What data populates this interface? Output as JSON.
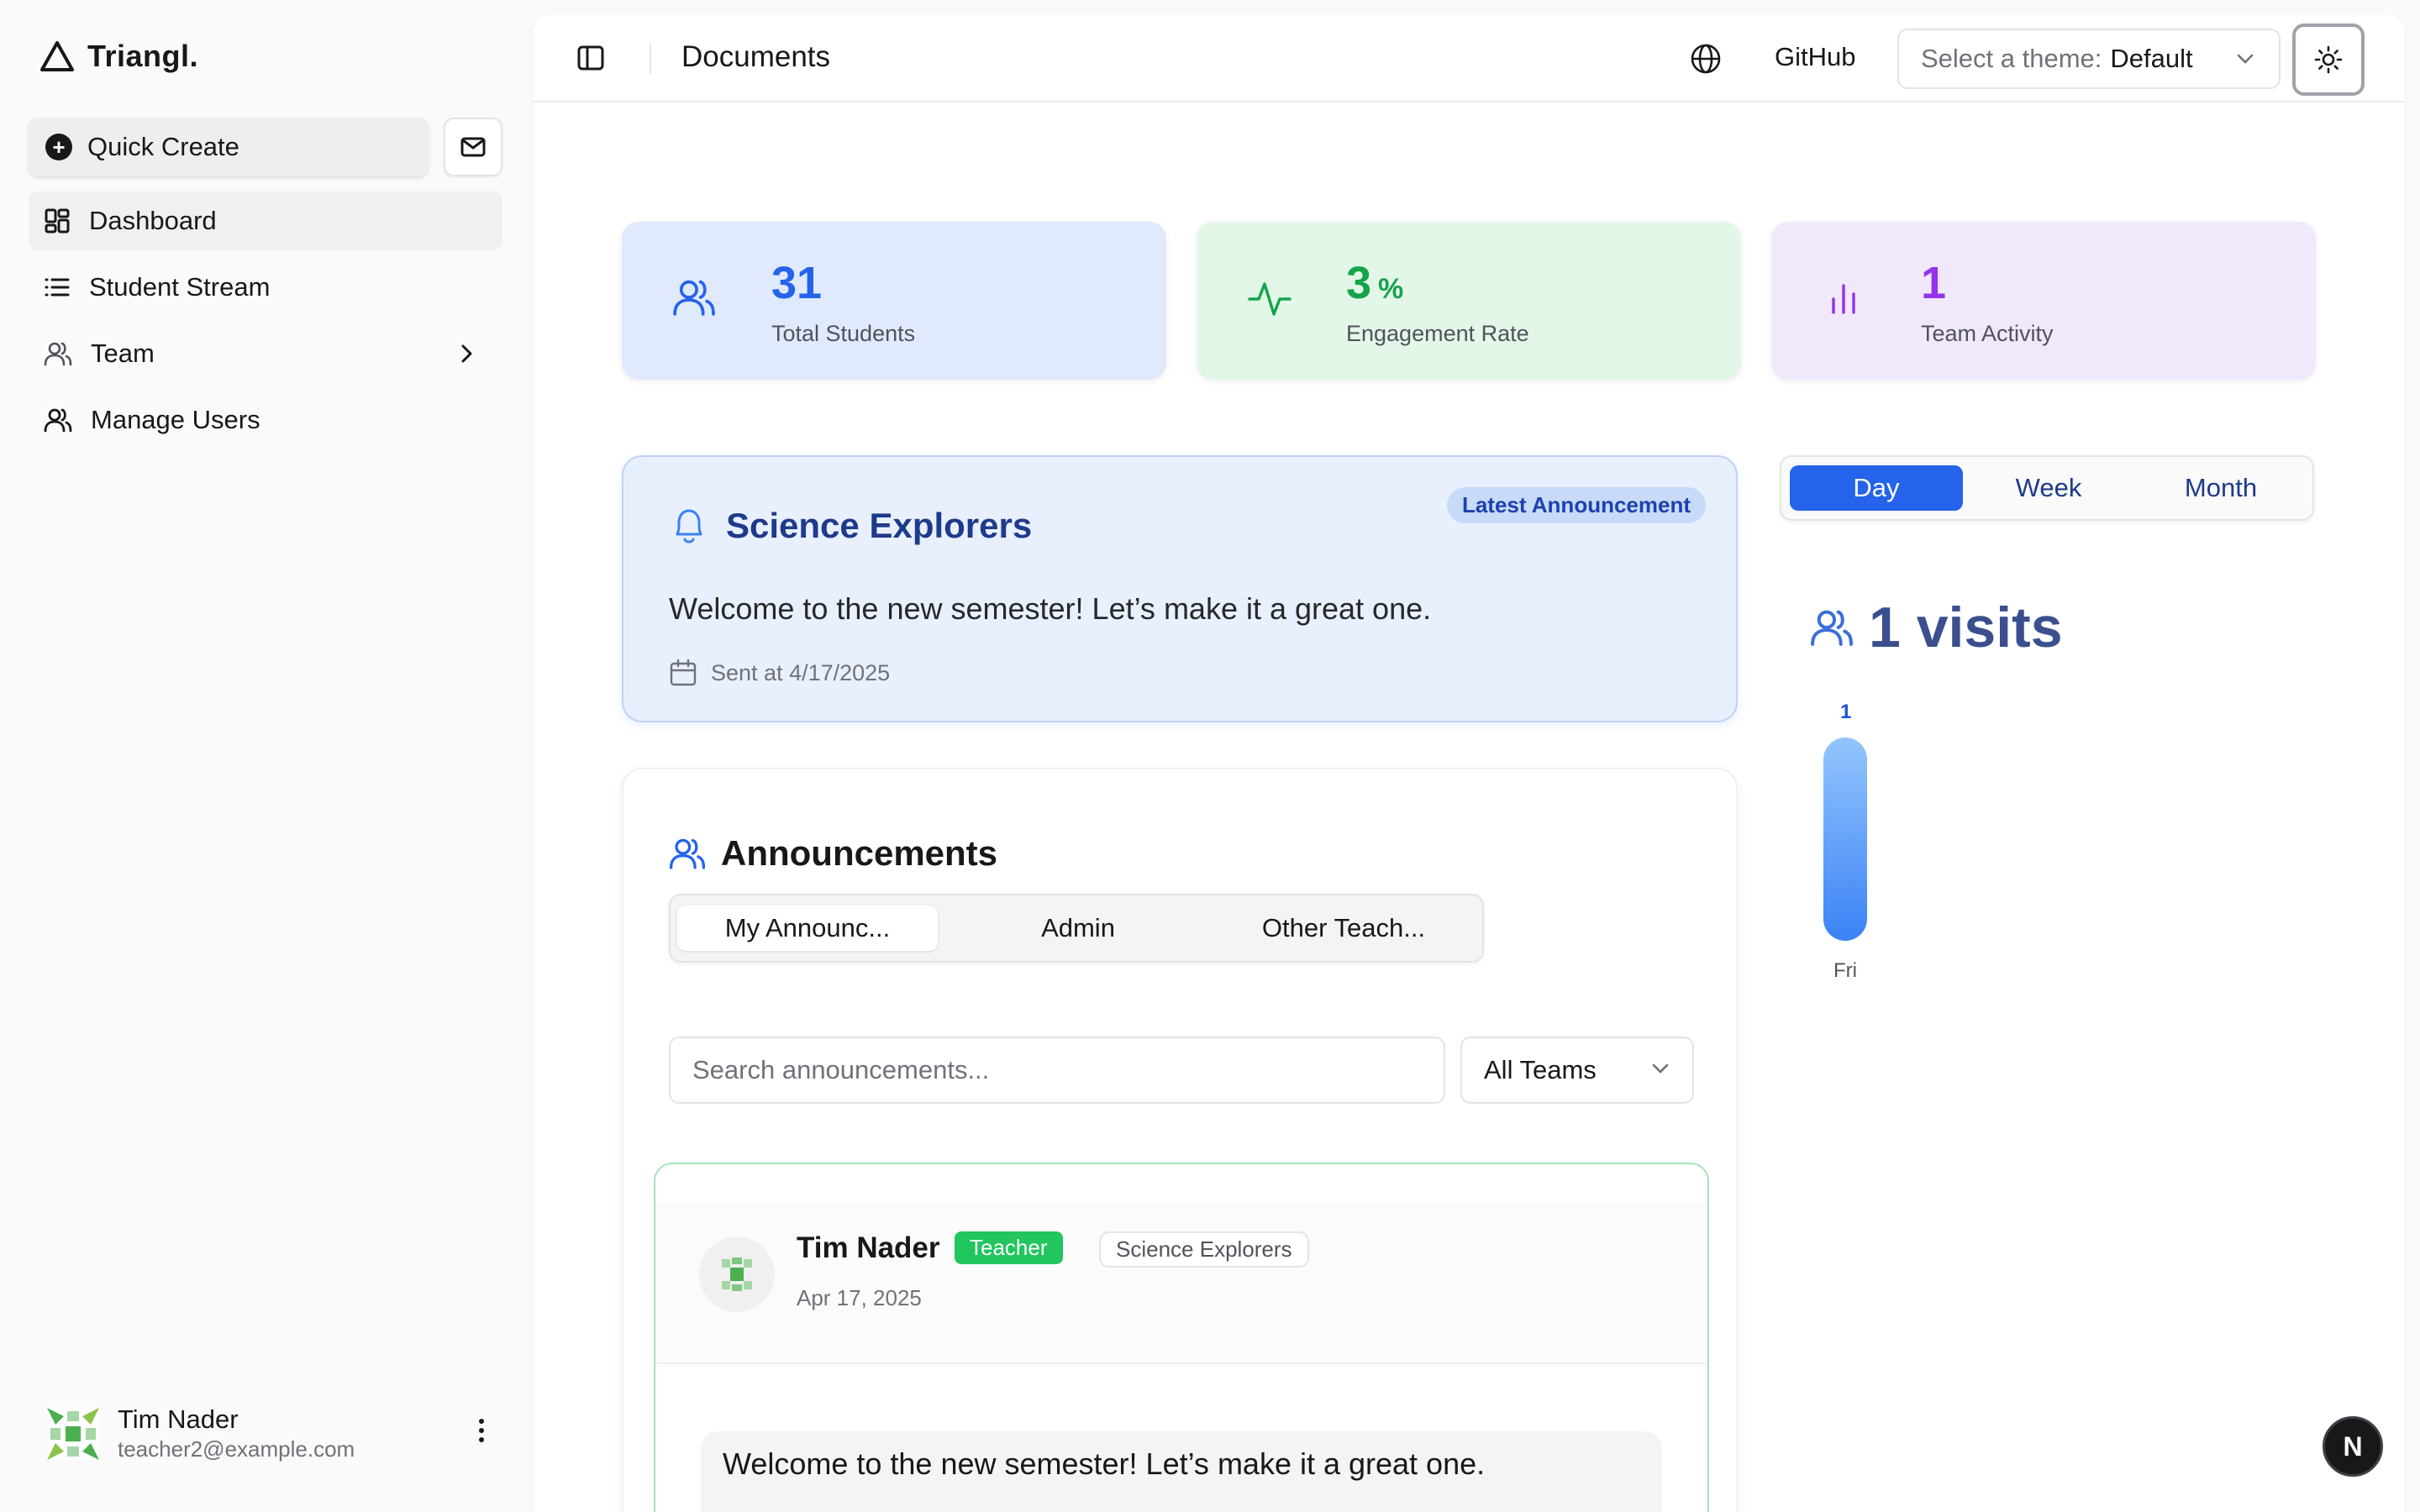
{
  "app": {
    "name": "Triangl."
  },
  "sidebar": {
    "quick_create_label": "Quick Create",
    "items": [
      {
        "label": "Dashboard",
        "icon": "dashboard-icon"
      },
      {
        "label": "Student Stream",
        "icon": "list-icon"
      },
      {
        "label": "Team",
        "icon": "users-icon"
      },
      {
        "label": "Manage Users",
        "icon": "user-cog-icon"
      }
    ],
    "user": {
      "name": "Tim Nader",
      "email": "teacher2@example.com"
    }
  },
  "header": {
    "title": "Documents",
    "github_label": "GitHub",
    "theme_label": "Select a theme:",
    "theme_value": "Default"
  },
  "stats": [
    {
      "value": "31",
      "unit": "",
      "label": "Total Students",
      "color": "#2563eb",
      "bg": "#e0eafc"
    },
    {
      "value": "3",
      "unit": "%",
      "label": "Engagement Rate",
      "color": "#16a34a",
      "bg": "#e2f7e8"
    },
    {
      "value": "1",
      "unit": "",
      "label": "Team Activity",
      "color": "#9333ea",
      "bg": "#f1e8fc"
    }
  ],
  "latest_announcement": {
    "badge": "Latest Announcement",
    "team": "Science Explorers",
    "message": "Welcome to the new semester! Let’s make it a great one.",
    "sent": "Sent at 4/17/2025"
  },
  "visits": {
    "tabs": [
      "Day",
      "Week",
      "Month"
    ],
    "active_tab": "Day",
    "summary": "1 visits",
    "chart_data": {
      "type": "bar",
      "categories": [
        "Fri"
      ],
      "values": [
        1
      ],
      "value_labels": [
        "1"
      ]
    }
  },
  "announcements": {
    "title": "Announcements",
    "tabs": [
      "My Announc...",
      "Admin",
      "Other Teach..."
    ],
    "search_placeholder": "Search announcements...",
    "team_filter": "All Teams",
    "post": {
      "author": "Tim Nader",
      "role": "Teacher",
      "team": "Science Explorers",
      "date": "Apr 17, 2025",
      "body": "Welcome to the new semester! Let’s make it a great one."
    }
  },
  "dev_badge": "N"
}
